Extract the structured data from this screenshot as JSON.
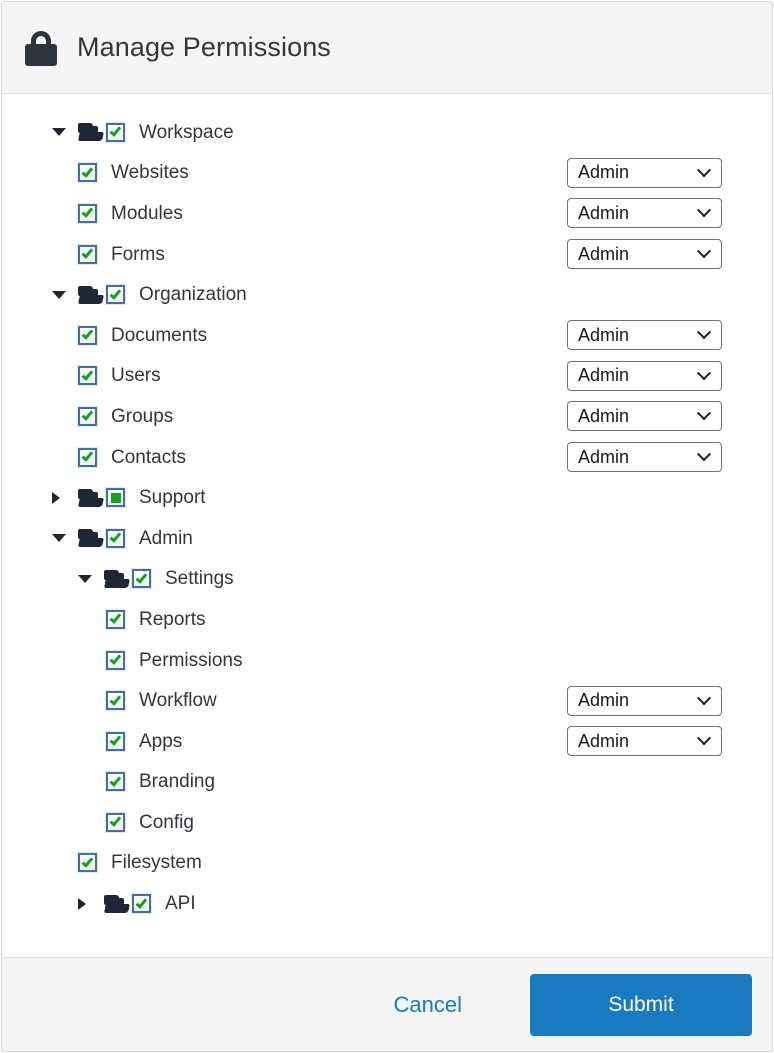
{
  "header": {
    "icon": "lock-icon",
    "title": "Manage Permissions"
  },
  "tree": {
    "nodes": [
      {
        "label": "Workspace",
        "depth": 0,
        "type": "folder",
        "expanded": true,
        "arrow": "down",
        "checkbox": "checked",
        "role": null
      },
      {
        "label": "Websites",
        "depth": 1,
        "type": "leaf",
        "expanded": null,
        "arrow": null,
        "checkbox": "checked",
        "role": "Admin"
      },
      {
        "label": "Modules",
        "depth": 1,
        "type": "leaf",
        "expanded": null,
        "arrow": null,
        "checkbox": "checked",
        "role": "Admin"
      },
      {
        "label": "Forms",
        "depth": 1,
        "type": "leaf",
        "expanded": null,
        "arrow": null,
        "checkbox": "checked",
        "role": "Admin"
      },
      {
        "label": "Organization",
        "depth": 0,
        "type": "folder",
        "expanded": true,
        "arrow": "down",
        "checkbox": "checked",
        "role": null
      },
      {
        "label": "Documents",
        "depth": 1,
        "type": "leaf",
        "expanded": null,
        "arrow": null,
        "checkbox": "checked",
        "role": "Admin"
      },
      {
        "label": "Users",
        "depth": 1,
        "type": "leaf",
        "expanded": null,
        "arrow": null,
        "checkbox": "checked",
        "role": "Admin"
      },
      {
        "label": "Groups",
        "depth": 1,
        "type": "leaf",
        "expanded": null,
        "arrow": null,
        "checkbox": "checked",
        "role": "Admin"
      },
      {
        "label": "Contacts",
        "depth": 1,
        "type": "leaf",
        "expanded": null,
        "arrow": null,
        "checkbox": "checked",
        "role": "Admin"
      },
      {
        "label": "Support",
        "depth": 0,
        "type": "folder",
        "expanded": false,
        "arrow": "right",
        "checkbox": "partial",
        "role": null
      },
      {
        "label": "Admin",
        "depth": 0,
        "type": "folder",
        "expanded": true,
        "arrow": "down",
        "checkbox": "checked",
        "role": null
      },
      {
        "label": "Settings",
        "depth": 1,
        "type": "folder",
        "expanded": true,
        "arrow": "down",
        "checkbox": "checked",
        "role": null
      },
      {
        "label": "Reports",
        "depth": 2,
        "type": "leaf",
        "expanded": null,
        "arrow": null,
        "checkbox": "checked",
        "role": null
      },
      {
        "label": "Permissions",
        "depth": 2,
        "type": "leaf",
        "expanded": null,
        "arrow": null,
        "checkbox": "checked",
        "role": null
      },
      {
        "label": "Workflow",
        "depth": 2,
        "type": "leaf",
        "expanded": null,
        "arrow": null,
        "checkbox": "checked",
        "role": "Admin"
      },
      {
        "label": "Apps",
        "depth": 2,
        "type": "leaf",
        "expanded": null,
        "arrow": null,
        "checkbox": "checked",
        "role": "Admin"
      },
      {
        "label": "Branding",
        "depth": 2,
        "type": "leaf",
        "expanded": null,
        "arrow": null,
        "checkbox": "checked",
        "role": null
      },
      {
        "label": "Config",
        "depth": 2,
        "type": "leaf",
        "expanded": null,
        "arrow": null,
        "checkbox": "checked",
        "role": null
      },
      {
        "label": "Filesystem",
        "depth": 1,
        "type": "leaf",
        "expanded": null,
        "arrow": null,
        "checkbox": "checked",
        "role": null
      },
      {
        "label": "API",
        "depth": 1,
        "type": "folder",
        "expanded": false,
        "arrow": "right",
        "checkbox": "checked",
        "role": null
      }
    ],
    "role_options": [
      "Admin"
    ]
  },
  "footer": {
    "cancel_label": "Cancel",
    "submit_label": "Submit"
  },
  "colors": {
    "accent": "#1a7abf",
    "check_green": "#18a022",
    "checkbox_border": "#3f72a0",
    "folder": "#202734",
    "header_bg": "#f5f5f5",
    "text": "#33373d"
  }
}
